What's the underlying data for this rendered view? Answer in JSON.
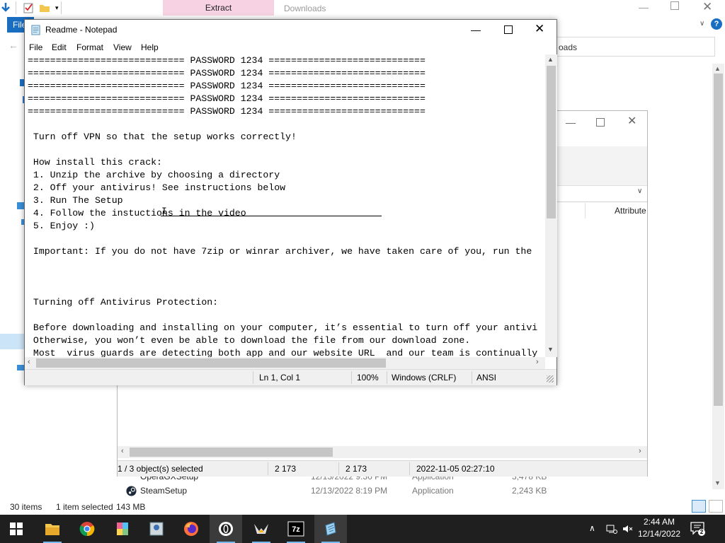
{
  "explorer": {
    "ribbon_tab_extract": "Extract",
    "ribbon_tab_downloads": "Downloads",
    "file_tab": "File",
    "help_label": "?",
    "address_text": "oads",
    "column_attributes": "Attribute",
    "rows": [
      {
        "name": "OperaGXSetup",
        "date": "12/13/2022 9:36 PM",
        "type": "Application",
        "size": "3,478 KB"
      },
      {
        "name": "SteamSetup",
        "date": "12/13/2022 8:19 PM",
        "type": "Application",
        "size": "2,243 KB"
      }
    ],
    "status": {
      "items": "30 items",
      "selected": "1 item selected",
      "size": "143 MB"
    }
  },
  "props_window": {
    "status": {
      "selection": "1 / 3 object(s) selected",
      "col1": "2 173",
      "col2": "2 173",
      "date": "2022-11-05 02:27:10"
    }
  },
  "notepad": {
    "title": "Readme - Notepad",
    "menu": [
      "File",
      "Edit",
      "Format",
      "View",
      "Help"
    ],
    "lines": [
      "============================ PASSWORD 1234 ============================",
      "============================ PASSWORD 1234 ============================",
      "============================ PASSWORD 1234 ============================",
      "============================ PASSWORD 1234 ============================",
      "============================ PASSWORD 1234 ============================",
      "",
      " Turn off VPN so that the setup works correctly!",
      "",
      " How install this crack:",
      " 1. Unzip the archive by choosing a directory",
      " 2. Off your antivirus! See instructions below",
      " 3. Run The Setup",
      " 4. Follow the instuctions in the video",
      " 5. Enjoy :)",
      "",
      " Important: If you do not have 7zip or winrar archiver, we have taken care of you, run the",
      "",
      "",
      "",
      " Turning off Antivirus Protection:",
      "",
      " Before downloading and installing on your computer, it’s essential to turn off your antivi",
      " Otherwise, you won’t even be able to download the file from our download zone.",
      " Most  virus guards are detecting both app and our website URL  and our team is continually"
    ],
    "status": {
      "position": "Ln 1, Col 1",
      "zoom": "100%",
      "line_ending": "Windows (CRLF)",
      "encoding": "ANSI"
    }
  },
  "taskbar": {
    "apps": [
      "start-icon",
      "file-explorer-icon",
      "chrome-icon",
      "colorful-app-icon",
      "media-app-icon",
      "firefox-icon",
      "opera-gx-icon",
      "game-app-icon",
      "7zip-icon",
      "notepad-icon"
    ],
    "clock": {
      "time": "2:44 AM",
      "date": "12/14/2022"
    }
  },
  "colors": {
    "accent": "#1a6ec2",
    "taskbar": "#1f1f1f",
    "extract_tab": "#f6d2e2"
  }
}
